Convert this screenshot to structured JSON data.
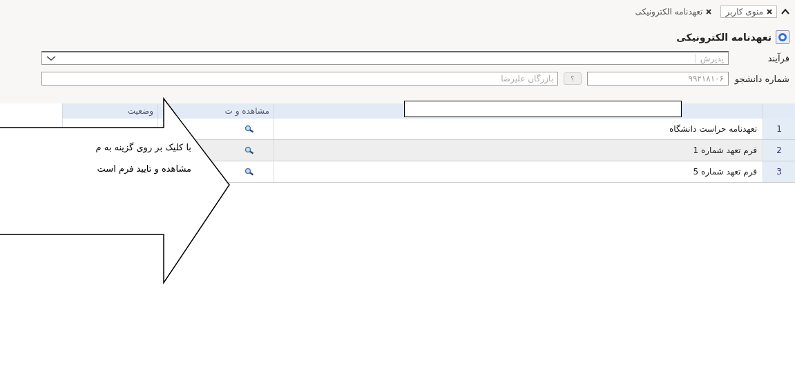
{
  "breadcrumb": {
    "tabs": [
      {
        "label": "منوی کاربر",
        "selected": true
      },
      {
        "label": "تعهدنامه الکترونیکی",
        "selected": false
      }
    ]
  },
  "title": "تعهدنامه الکترونیکی",
  "form": {
    "process": {
      "label": "فرآیند",
      "value": "پذیرش"
    },
    "student": {
      "label": "شماره دانشجو",
      "number": "۹۹۲۱۸۱۰۶",
      "help": "؟",
      "name": "بازرگان علیرضا"
    }
  },
  "table": {
    "columns": [
      "مشاهده و ت",
      "وضعیت"
    ],
    "rows": [
      {
        "index": "1",
        "title": "تعهدنامه حراست دانشگاه",
        "selected": false
      },
      {
        "index": "2",
        "title": "فرم تعهد شماره 1",
        "selected": true
      },
      {
        "index": "3",
        "title": "فرم تعهد شماره 5",
        "selected": false
      }
    ]
  },
  "callout": {
    "lines": [
      "با کلیک بر روی گزینه به م",
      "مشاهده و تایید فرم است"
    ]
  }
}
